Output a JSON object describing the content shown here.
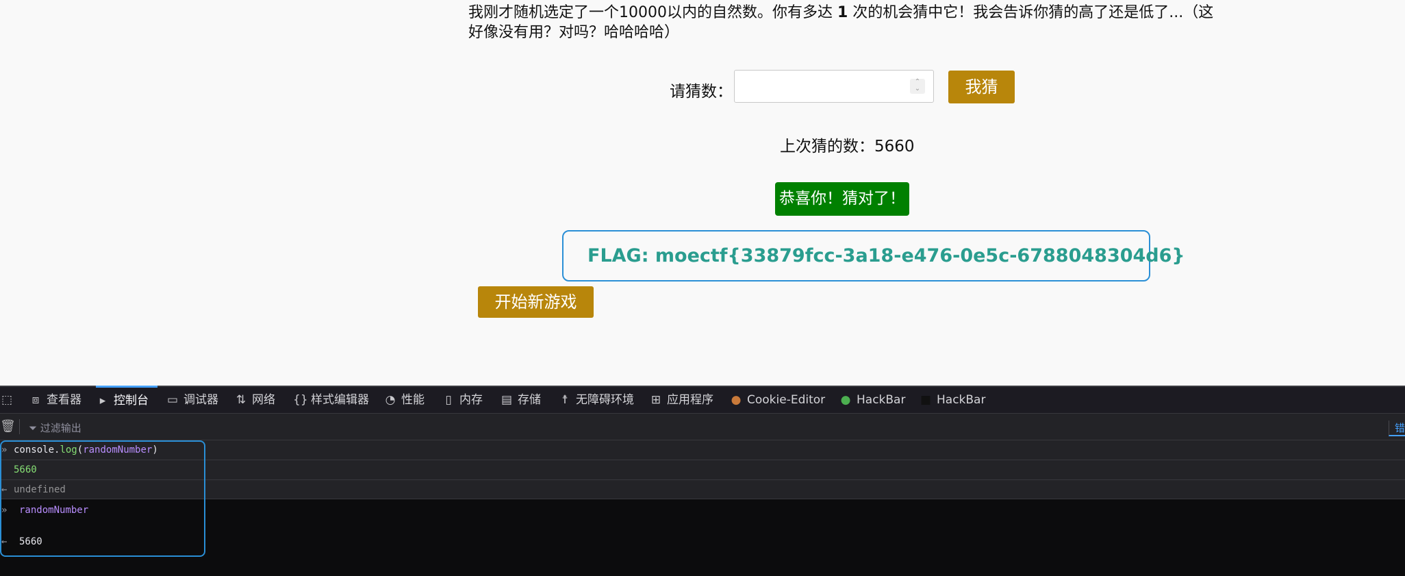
{
  "page": {
    "intro_before": "我刚才随机选定了一个10000以内的自然数。你有多达 ",
    "intro_bold": "1",
    "intro_after": " 次的机会猜中它！我会告诉你猜的高了还是低了...（这好像没有用？对吗？哈哈哈哈）",
    "guess_label": "请猜数：",
    "guess_input_value": "",
    "guess_button": "我猜",
    "last_guess": "上次猜的数：5660",
    "result": "恭喜你！猜对了！",
    "flag": "FLAG: moectf{33879fcc-3a18-e476-0e5c-6788048304d6}",
    "new_game_button": "开始新游戏"
  },
  "devtools": {
    "tabs": [
      {
        "label": "查看器",
        "icon": "inspector-icon"
      },
      {
        "label": "控制台",
        "icon": "console-icon",
        "active": true
      },
      {
        "label": "调试器",
        "icon": "debugger-icon"
      },
      {
        "label": "网络",
        "icon": "network-icon"
      },
      {
        "label": "样式编辑器",
        "icon": "style-editor-icon"
      },
      {
        "label": "性能",
        "icon": "performance-icon"
      },
      {
        "label": "内存",
        "icon": "memory-icon"
      },
      {
        "label": "存储",
        "icon": "storage-icon"
      },
      {
        "label": "无障碍环境",
        "icon": "accessibility-icon"
      },
      {
        "label": "应用程序",
        "icon": "application-icon"
      },
      {
        "label": "Cookie-Editor",
        "icon": "cookie-icon"
      },
      {
        "label": "HackBar",
        "icon": "hackbar-green-icon"
      },
      {
        "label": "HackBar",
        "icon": "hackbar-dark-icon"
      }
    ],
    "filter_placeholder": "过滤输出",
    "right_tab": "错",
    "console": {
      "input1_obj": "console",
      "input1_dot": ".",
      "input1_fn": "log",
      "input1_open": "(",
      "input1_arg": "randomNumber",
      "input1_close": ")",
      "log_output": "5660",
      "return1": "undefined",
      "input2": "randomNumber",
      "return2": "5660"
    }
  }
}
